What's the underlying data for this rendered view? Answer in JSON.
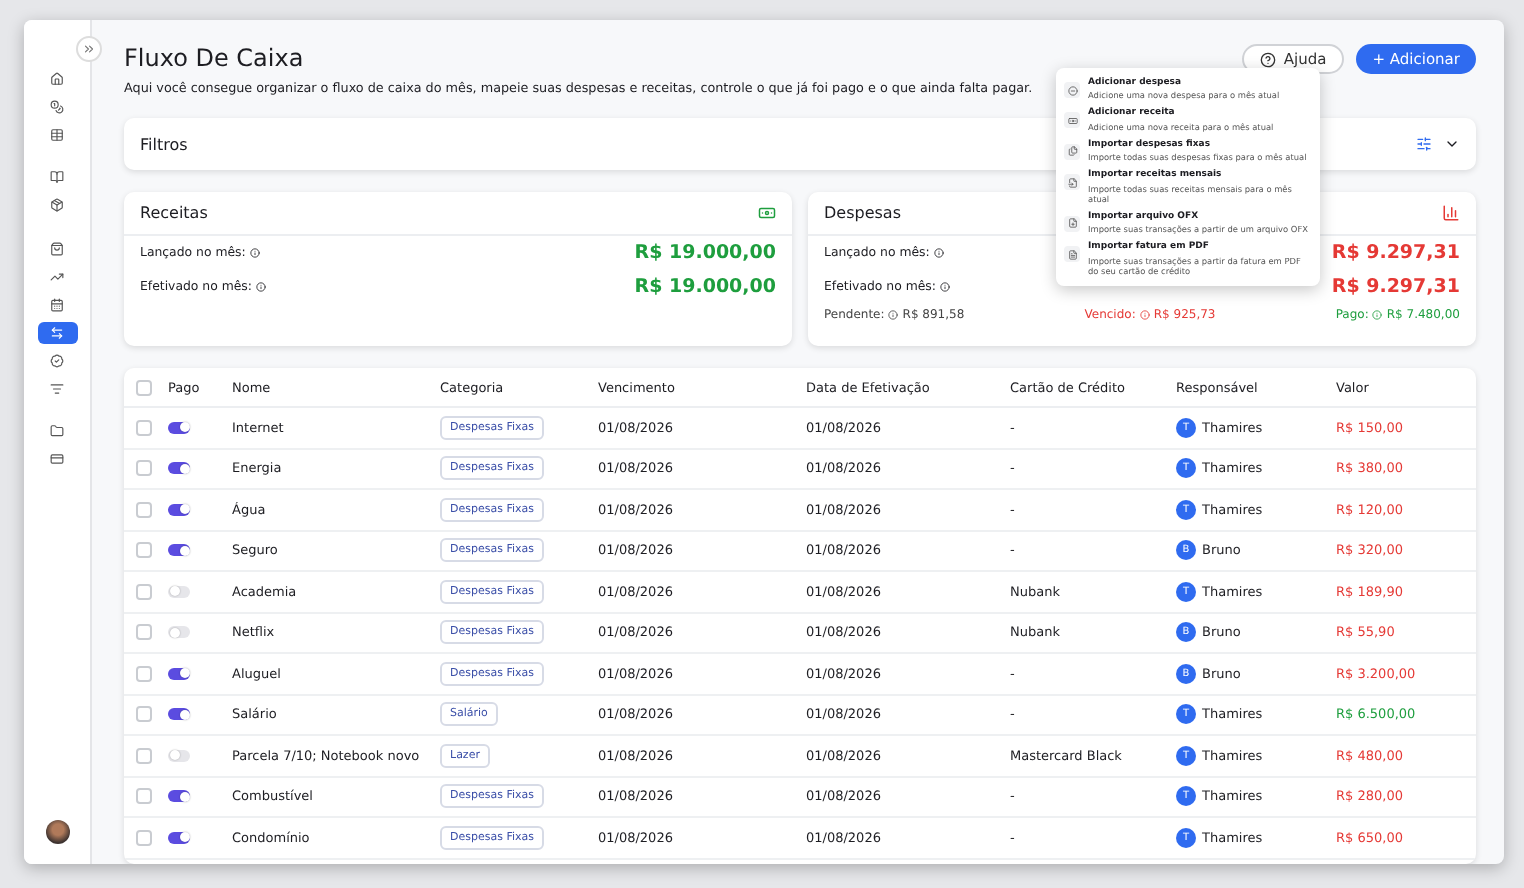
{
  "sidebar": {
    "items": [
      {
        "selected": false
      },
      {
        "selected": false
      },
      {
        "selected": false
      },
      {
        "selected": false
      },
      {
        "selected": false
      },
      {
        "selected": false
      },
      {
        "selected": false
      },
      {
        "selected": false
      },
      {
        "selected": true
      },
      {
        "selected": false
      },
      {
        "selected": false
      },
      {
        "selected": false
      },
      {
        "selected": false
      }
    ]
  },
  "header": {
    "title": "Fluxo De Caixa",
    "subtitle": "Aqui você consegue organizar o fluxo de caixa do mês, mapeie suas despesas e receitas, controle o que já foi pago e o que ainda falta pagar.",
    "help_button": "Ajuda",
    "add_button": "+ Adicionar"
  },
  "add_menu": [
    {
      "title": "Adicionar despesa",
      "description": "Adicione uma nova despesa para o mês atual"
    },
    {
      "title": "Adicionar receita",
      "description": "Adicione uma nova receita para o mês atual"
    },
    {
      "title": "Importar despesas fixas",
      "description": "Importe todas suas despesas fixas para o mês atual"
    },
    {
      "title": "Importar receitas mensais",
      "description": "Importe todas suas receitas mensais para o mês atual"
    },
    {
      "title": "Importar arquivo OFX",
      "description": "Importe suas transações a partir de um arquivo OFX"
    },
    {
      "title": "Importar fatura em PDF",
      "description": "Importe suas transações a partir da fatura em PDF do seu cartão de crédito"
    }
  ],
  "filters": {
    "title": "Filtros"
  },
  "income": {
    "title": "Receitas",
    "rows": [
      {
        "label": "Lançado no mês:",
        "value": "R$ 19.000,00"
      },
      {
        "label": "Efetivado no mês:",
        "value": "R$ 19.000,00"
      }
    ]
  },
  "expenses": {
    "title": "Despesas",
    "rows": [
      {
        "label": "Lançado no mês:",
        "value": "R$ 9.297,31"
      },
      {
        "label": "Efetivado no mês:",
        "value": "R$ 9.297,31"
      }
    ],
    "summary": [
      {
        "kind": "pending",
        "label": "Pendente:",
        "value": "R$ 891,58"
      },
      {
        "kind": "overdue",
        "label": "Vencido:",
        "value": "R$ 925,73"
      },
      {
        "kind": "paid",
        "label": "Pago:",
        "value": "R$ 7.480,00"
      }
    ]
  },
  "table": {
    "all_selected": false,
    "columns": [
      "Pago",
      "Nome",
      "Categoria",
      "Vencimento",
      "Data de Efetivação",
      "Cartão de Crédito",
      "Responsável",
      "Valor"
    ],
    "rows": [
      {
        "selected": false,
        "paid": true,
        "name": "Internet",
        "category": "Despesas Fixas",
        "due": "01/08/2026",
        "effective": "01/08/2026",
        "card": "-",
        "initial": "T",
        "responsible": "Thamires",
        "value": "R$ 150,00",
        "kind": "expense"
      },
      {
        "selected": false,
        "paid": true,
        "name": "Energia",
        "category": "Despesas Fixas",
        "due": "01/08/2026",
        "effective": "01/08/2026",
        "card": "-",
        "initial": "T",
        "responsible": "Thamires",
        "value": "R$ 380,00",
        "kind": "expense"
      },
      {
        "selected": false,
        "paid": true,
        "name": "Água",
        "category": "Despesas Fixas",
        "due": "01/08/2026",
        "effective": "01/08/2026",
        "card": "-",
        "initial": "T",
        "responsible": "Thamires",
        "value": "R$ 120,00",
        "kind": "expense"
      },
      {
        "selected": false,
        "paid": true,
        "name": "Seguro",
        "category": "Despesas Fixas",
        "due": "01/08/2026",
        "effective": "01/08/2026",
        "card": "-",
        "initial": "B",
        "responsible": "Bruno",
        "value": "R$ 320,00",
        "kind": "expense"
      },
      {
        "selected": false,
        "paid": false,
        "name": "Academia",
        "category": "Despesas Fixas",
        "due": "01/08/2026",
        "effective": "01/08/2026",
        "card": "Nubank",
        "initial": "T",
        "responsible": "Thamires",
        "value": "R$ 189,90",
        "kind": "expense"
      },
      {
        "selected": false,
        "paid": false,
        "name": "Netflix",
        "category": "Despesas Fixas",
        "due": "01/08/2026",
        "effective": "01/08/2026",
        "card": "Nubank",
        "initial": "B",
        "responsible": "Bruno",
        "value": "R$ 55,90",
        "kind": "expense"
      },
      {
        "selected": false,
        "paid": true,
        "name": "Aluguel",
        "category": "Despesas Fixas",
        "due": "01/08/2026",
        "effective": "01/08/2026",
        "card": "-",
        "initial": "B",
        "responsible": "Bruno",
        "value": "R$ 3.200,00",
        "kind": "expense"
      },
      {
        "selected": false,
        "paid": true,
        "name": "Salário",
        "category": "Salário",
        "due": "01/08/2026",
        "effective": "01/08/2026",
        "card": "-",
        "initial": "T",
        "responsible": "Thamires",
        "value": "R$ 6.500,00",
        "kind": "income"
      },
      {
        "selected": false,
        "paid": false,
        "name": "Parcela 7/10; Notebook novo",
        "category": "Lazer",
        "due": "01/08/2026",
        "effective": "01/08/2026",
        "card": "Mastercard Black",
        "initial": "T",
        "responsible": "Thamires",
        "value": "R$ 480,00",
        "kind": "expense"
      },
      {
        "selected": false,
        "paid": true,
        "name": "Combustível",
        "category": "Despesas Fixas",
        "due": "01/08/2026",
        "effective": "01/08/2026",
        "card": "-",
        "initial": "T",
        "responsible": "Thamires",
        "value": "R$ 280,00",
        "kind": "expense"
      },
      {
        "selected": false,
        "paid": true,
        "name": "Condomínio",
        "category": "Despesas Fixas",
        "due": "01/08/2026",
        "effective": "01/08/2026",
        "card": "-",
        "initial": "T",
        "responsible": "Thamires",
        "value": "R$ 650,00",
        "kind": "expense"
      }
    ]
  }
}
